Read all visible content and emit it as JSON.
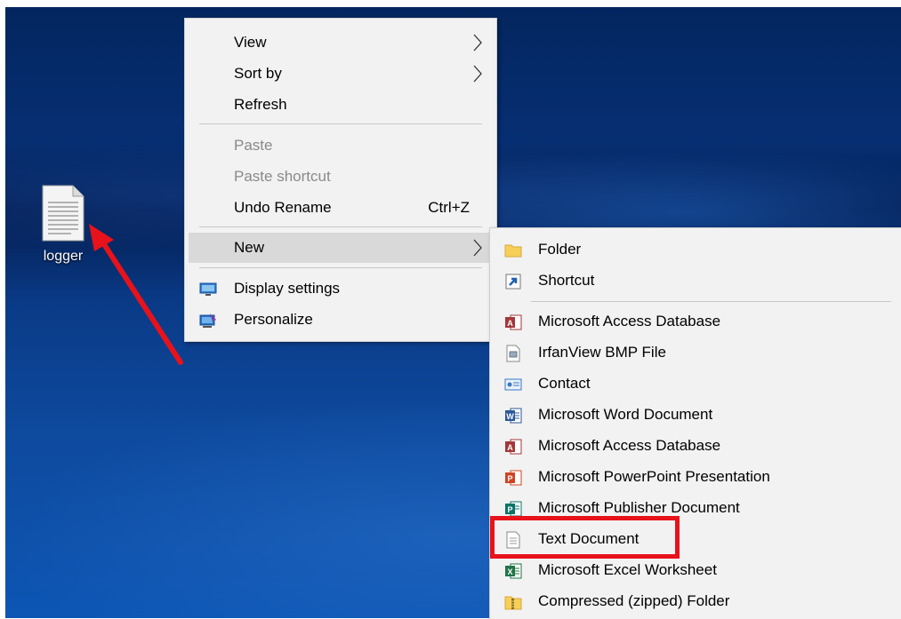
{
  "desktop": {
    "file_icon": {
      "icon": "text-file-icon",
      "label": "logger"
    }
  },
  "context_menu": {
    "items": [
      {
        "label": "View",
        "submenu": true
      },
      {
        "label": "Sort by",
        "submenu": true
      },
      {
        "label": "Refresh"
      },
      {
        "label": "Paste",
        "disabled": true
      },
      {
        "label": "Paste shortcut",
        "disabled": true
      },
      {
        "label": "Undo Rename",
        "shortcut": "Ctrl+Z"
      },
      {
        "label": "New",
        "submenu": true,
        "highlighted": true
      },
      {
        "label": "Display settings",
        "icon": "display-settings-icon"
      },
      {
        "label": "Personalize",
        "icon": "personalize-icon"
      }
    ]
  },
  "new_submenu": {
    "items": [
      {
        "label": "Folder",
        "icon": "folder-icon"
      },
      {
        "label": "Shortcut",
        "icon": "shortcut-icon"
      },
      {
        "label": "Microsoft Access Database",
        "icon": "access-icon"
      },
      {
        "label": "IrfanView BMP File",
        "icon": "bmp-file-icon"
      },
      {
        "label": "Contact",
        "icon": "contact-icon"
      },
      {
        "label": "Microsoft Word Document",
        "icon": "word-icon"
      },
      {
        "label": "Microsoft Access Database",
        "icon": "access-icon"
      },
      {
        "label": "Microsoft PowerPoint Presentation",
        "icon": "powerpoint-icon"
      },
      {
        "label": "Microsoft Publisher Document",
        "icon": "publisher-icon"
      },
      {
        "label": "Text Document",
        "icon": "text-document-icon",
        "annotated": true
      },
      {
        "label": "Microsoft Excel Worksheet",
        "icon": "excel-icon"
      },
      {
        "label": "Compressed (zipped) Folder",
        "icon": "zip-folder-icon"
      }
    ]
  },
  "annotation": {
    "color": "#e8121b"
  }
}
